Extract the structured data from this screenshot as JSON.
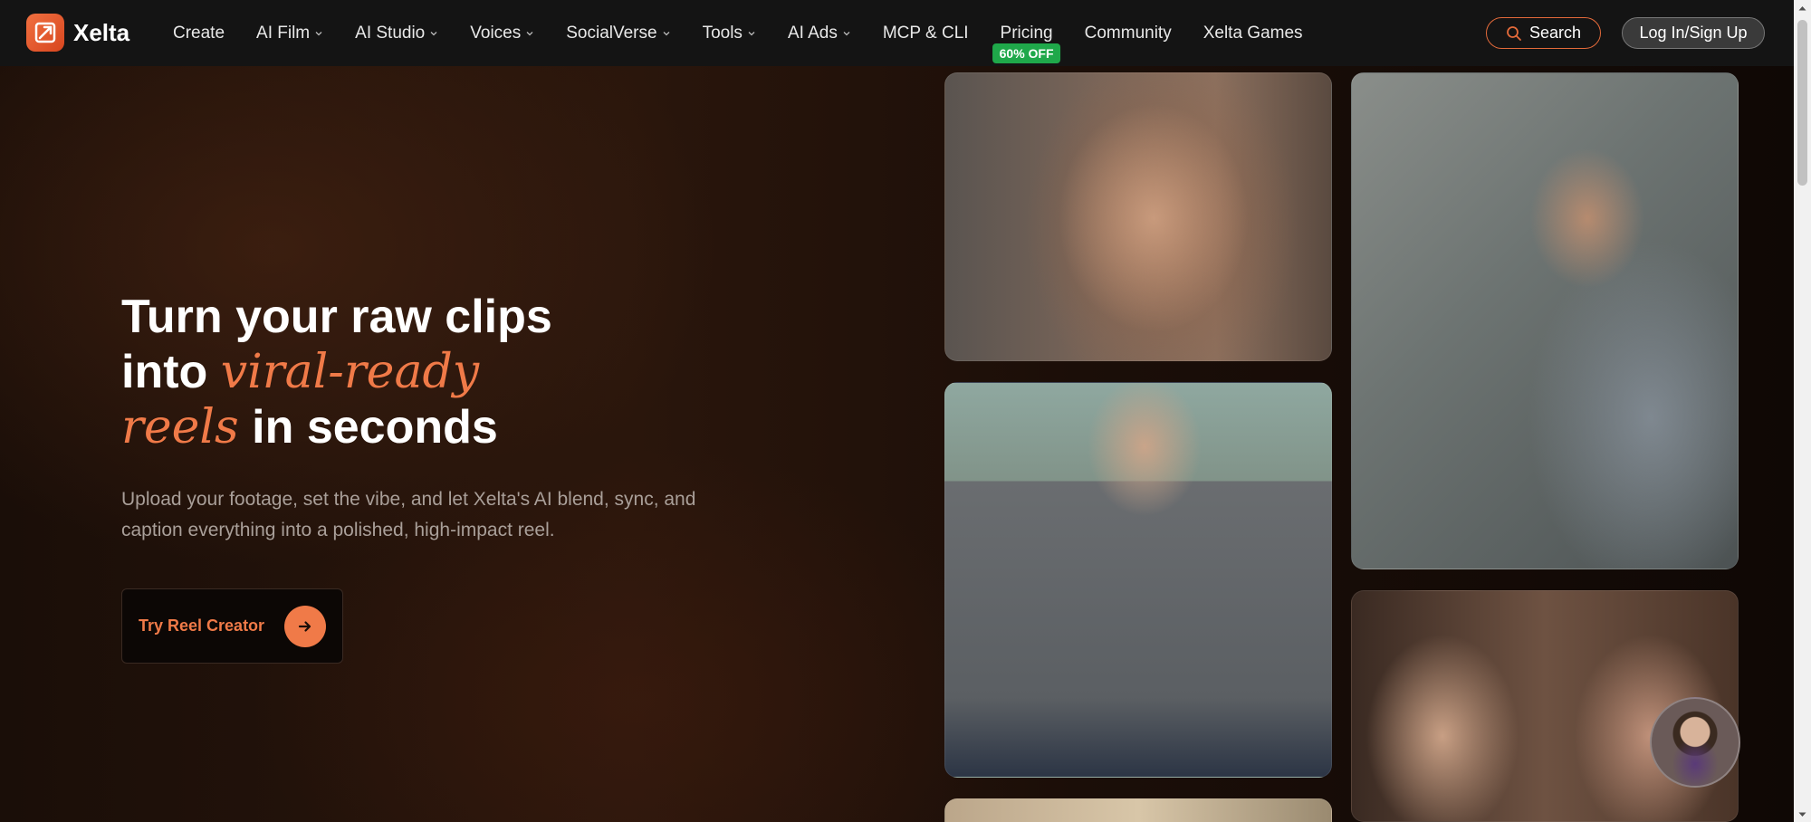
{
  "brand": {
    "name": "Xelta"
  },
  "nav": {
    "items": [
      {
        "label": "Create",
        "dropdown": false
      },
      {
        "label": "AI Film",
        "dropdown": true
      },
      {
        "label": "AI Studio",
        "dropdown": true
      },
      {
        "label": "Voices",
        "dropdown": true
      },
      {
        "label": "SocialVerse",
        "dropdown": true
      },
      {
        "label": "Tools",
        "dropdown": true
      },
      {
        "label": "AI Ads",
        "dropdown": true
      },
      {
        "label": "MCP & CLI",
        "dropdown": false
      },
      {
        "label": "Pricing",
        "dropdown": false
      },
      {
        "label": "Community",
        "dropdown": false
      },
      {
        "label": "Xelta Games",
        "dropdown": false
      }
    ],
    "pricing_badge": "60% OFF",
    "search_label": "Search",
    "login_label": "Log In/Sign Up"
  },
  "hero": {
    "headline_part1": "Turn your raw clips",
    "headline_part2": "into ",
    "headline_accent1": "viral-ready",
    "headline_accent2": "reels",
    "headline_part3": " in seconds",
    "subtext": "Upload your footage, set the vibe, and let Xelta's AI blend, sync, and caption everything into a polished, high-impact reel.",
    "cta_label": "Try Reel Creator"
  },
  "colors": {
    "accent": "#f07a48",
    "badge_green": "#1fa84a",
    "nav_bg": "#141414"
  },
  "icons": {
    "logo": "xelta-logo-icon",
    "search": "search-icon",
    "cta": "arrow-right-icon",
    "dropdown": "chevron-down-icon"
  }
}
